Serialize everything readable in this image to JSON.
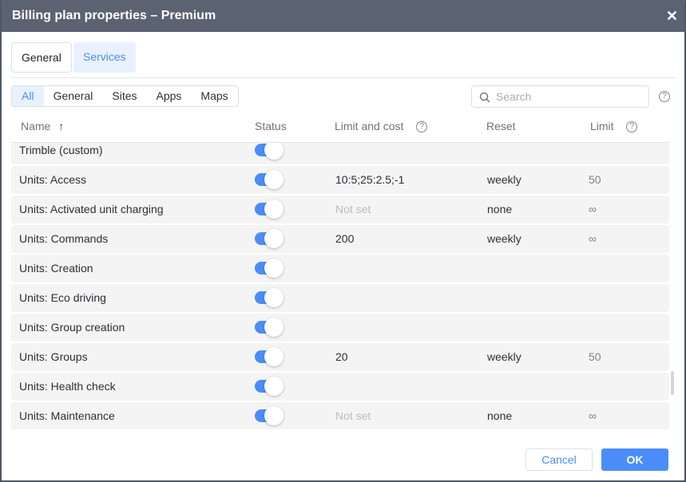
{
  "title": "Billing plan properties – Premium",
  "tabs": {
    "general": "General",
    "services": "Services"
  },
  "filters": [
    "All",
    "General",
    "Sites",
    "Apps",
    "Maps"
  ],
  "search": {
    "placeholder": "Search"
  },
  "columns": {
    "name": "Name",
    "sort": "↑",
    "status": "Status",
    "limit_cost": "Limit and cost",
    "reset": "Reset",
    "limit": "Limit",
    "help": "?"
  },
  "rows": [
    {
      "name": "Trimble (custom)",
      "limit_cost": "",
      "reset": "",
      "limit": ""
    },
    {
      "name": "Units: Access",
      "limit_cost": "10:5;25:2.5;-1",
      "reset": "weekly",
      "limit": "50"
    },
    {
      "name": "Units: Activated unit charging",
      "limit_cost": "Not set",
      "reset": "none",
      "limit": "∞"
    },
    {
      "name": "Units: Commands",
      "limit_cost": "200",
      "reset": "weekly",
      "limit": "∞"
    },
    {
      "name": "Units: Creation",
      "limit_cost": "",
      "reset": "",
      "limit": ""
    },
    {
      "name": "Units: Eco driving",
      "limit_cost": "",
      "reset": "",
      "limit": ""
    },
    {
      "name": "Units: Group creation",
      "limit_cost": "",
      "reset": "",
      "limit": ""
    },
    {
      "name": "Units: Groups",
      "limit_cost": "20",
      "reset": "weekly",
      "limit": "50"
    },
    {
      "name": "Units: Health check",
      "limit_cost": "",
      "reset": "",
      "limit": ""
    },
    {
      "name": "Units: Maintenance",
      "limit_cost": "Not set",
      "reset": "none",
      "limit": "∞"
    }
  ],
  "buttons": {
    "cancel": "Cancel",
    "ok": "OK"
  }
}
